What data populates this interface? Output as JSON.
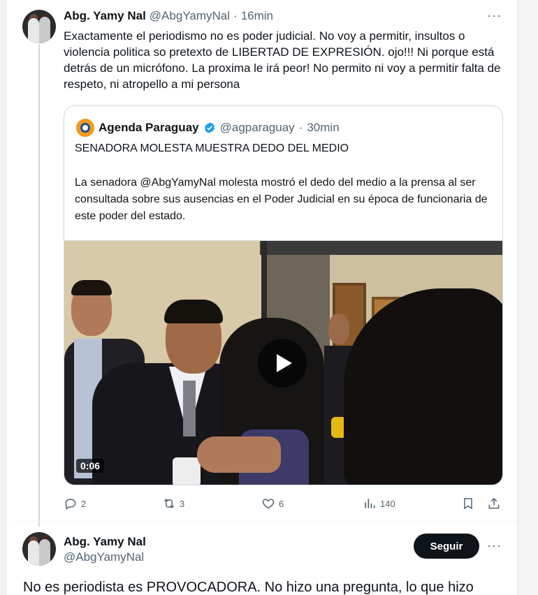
{
  "tweet": {
    "author_name": "Abg. Yamy Nal",
    "handle": "@AbgYamyNal",
    "separator": "·",
    "time": "16min",
    "more": "···",
    "text": "Exactamente el periodismo no es poder judicial. No voy a permitir, insultos o violencia politica  so pretexto de LIBERTAD DE EXPRESIÓN. ojo!!! Ni porque está detrás de un micrófono. La proxima le irá peor! No permito ni voy a permitir falta de respeto, ni atropello a mi persona"
  },
  "quote": {
    "author_name": "Agenda Paraguay",
    "handle": "@agparaguay",
    "separator": "·",
    "time": "30min",
    "title": "SENADORA MOLESTA MUESTRA DEDO DEL MEDIO",
    "body": "La senadora @AbgYamyNal molesta mostró el dedo del medio a la prensa al ser consultada sobre sus ausencias en el Poder Judicial en su época de funcionaria de este poder del estado.",
    "video_duration": "0:06"
  },
  "actions": {
    "replies": "2",
    "reposts": "3",
    "likes": "6",
    "views": "140"
  },
  "reply": {
    "author_name": "Abg. Yamy Nal",
    "handle": "@AbgYamyNal",
    "follow_label": "Seguir",
    "more": "···",
    "text": "No es periodista es PROVOCADORA. No hizo una pregunta, lo que hizo"
  },
  "colors": {
    "text": "#0f1419",
    "muted": "#536471",
    "border": "#cfd9de",
    "verified": "#1d9bf0"
  }
}
